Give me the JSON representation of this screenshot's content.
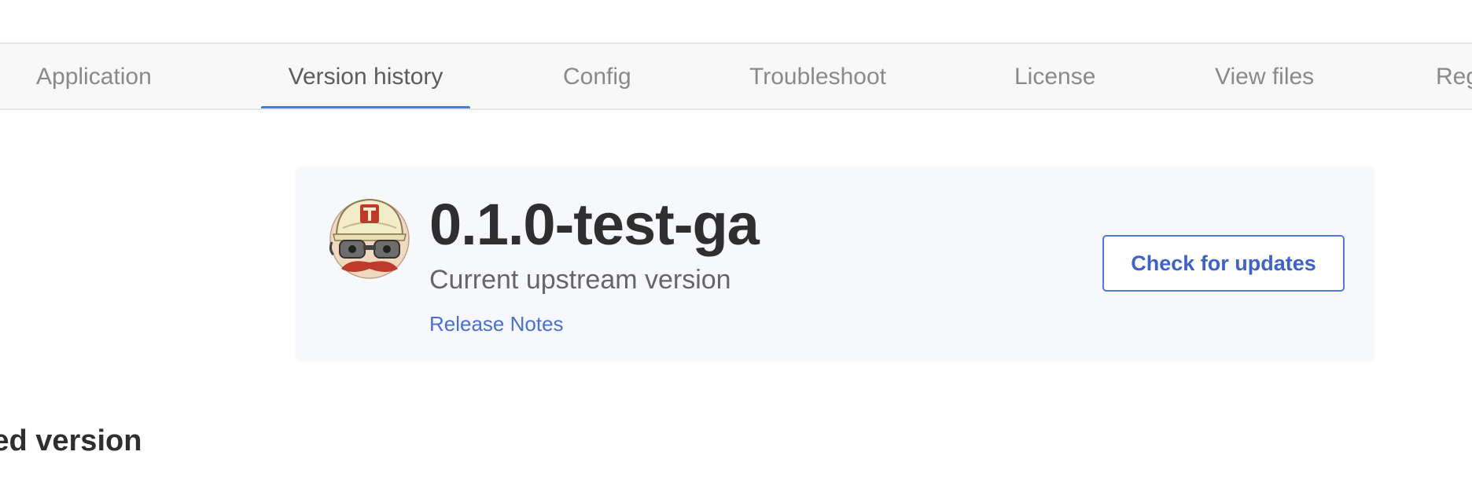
{
  "tabs": [
    {
      "label": "Application",
      "active": false
    },
    {
      "label": "Version history",
      "active": true
    },
    {
      "label": "Config",
      "active": false
    },
    {
      "label": "Troubleshoot",
      "active": false
    },
    {
      "label": "License",
      "active": false
    },
    {
      "label": "View files",
      "active": false
    },
    {
      "label": "Reg",
      "active": false
    }
  ],
  "accent_color": "#4f7ad8",
  "upstream": {
    "version": "0.1.0-test-ga",
    "subtitle": "Current upstream version",
    "release_notes_label": "Release Notes",
    "app_icon": "mascot-avatar-icon"
  },
  "actions": {
    "check_updates_label": "Check for updates"
  },
  "sections": {
    "deployed_heading": "oyed version"
  }
}
